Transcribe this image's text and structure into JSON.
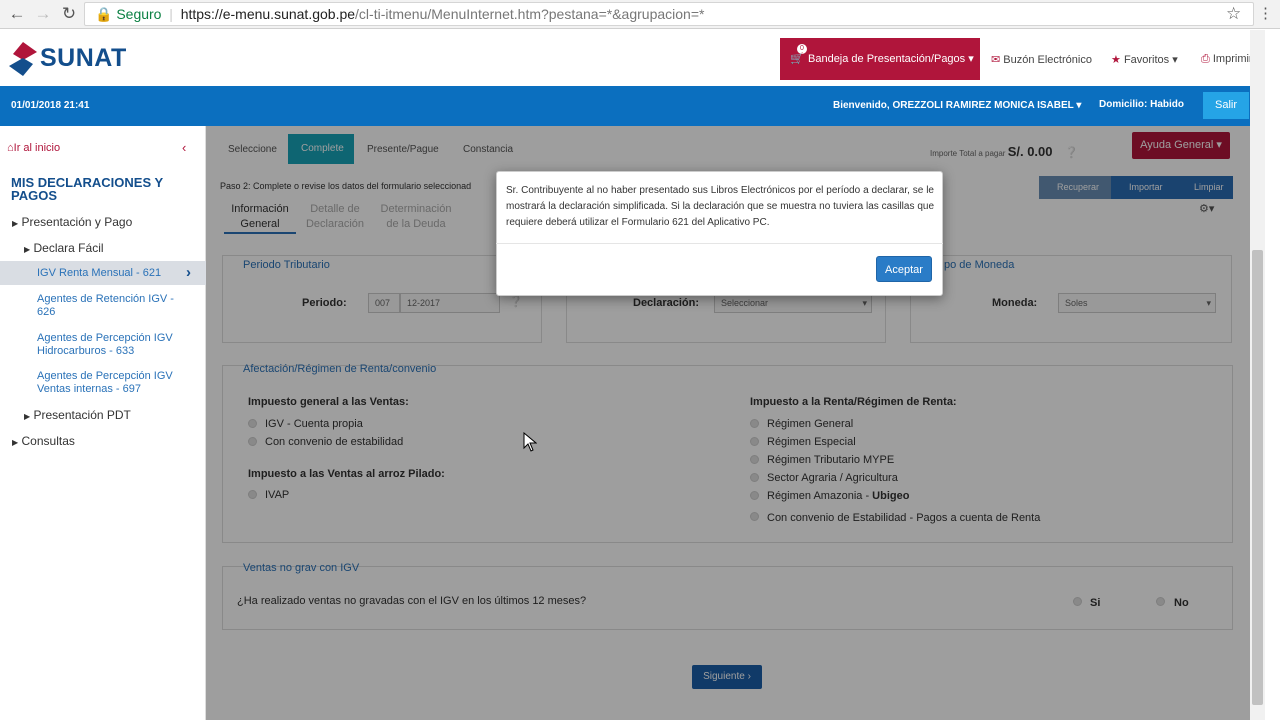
{
  "browser": {
    "secure_label": "Seguro",
    "url_host": "https://e-menu.sunat.gob.pe",
    "url_path": "/cl-ti-itmenu/MenuInternet.htm?pestana=*&agrupacion=*"
  },
  "header": {
    "logo_text": "SUNAT",
    "bandeja_label": "Bandeja de Presentación/Pagos",
    "bandeja_badge": "0",
    "buzon_label": "Buzón Electrónico",
    "favoritos_label": "Favoritos",
    "imprimir_label": "Imprimir"
  },
  "bluebar": {
    "datetime": "01/01/2018 21:41",
    "welcome": "Bienvenido, OREZZOLI RAMIREZ MONICA ISABEL",
    "domicilio": "Domicilio: Habido",
    "salir_label": "Salir"
  },
  "sidebar": {
    "ir_inicio": "Ir al inicio",
    "title": "MIS DECLARACIONES Y PAGOS",
    "presentacion_pago": "Presentación y Pago",
    "declara_facil": "Declara Fácil",
    "items": [
      "IGV Renta Mensual - 621",
      "Agentes de Retención IGV - 626",
      "Agentes de Percepción IGV Hidrocarburos - 633",
      "Agentes de Percepción IGV Ventas internas - 697"
    ],
    "presentacion_pdt": "Presentación PDT",
    "consultas": "Consultas"
  },
  "steps": [
    "Seleccione",
    "Complete",
    "Presente/Pague",
    "Constancia"
  ],
  "importe": {
    "label": "Importe Total a pagar",
    "value": "S/. 0.00"
  },
  "ayuda_label": "Ayuda General",
  "paso_text": "Paso 2: Complete o revise los datos del formulario seleccionad",
  "toolbar": {
    "recuperar": "Recuperar",
    "importar": "Importar",
    "limpiar": "Limpiar"
  },
  "tabs": {
    "info_general": "Información General",
    "detalle": "Detalle de Declaración",
    "determinacion": "Determinación de la Deuda"
  },
  "periodo": {
    "legend": "Periodo Tributario",
    "label": "Periodo:",
    "code": "007",
    "value": "12-2017"
  },
  "declaracion": {
    "label": "Declaración:",
    "value": "Seleccionar"
  },
  "moneda": {
    "legend": "Tipo de Moneda",
    "legend_visible": "po de Moneda",
    "label": "Moneda:",
    "value": "Soles"
  },
  "afectacion": {
    "legend": "Afectación/Régimen de Renta/convenio",
    "igv_heading": "Impuesto general a las Ventas:",
    "igv_options": [
      "IGV - Cuenta propia",
      "Con convenio de estabilidad"
    ],
    "arroz_heading": "Impuesto a las Ventas al arroz Pilado:",
    "arroz_options": [
      "IVAP"
    ],
    "renta_heading": "Impuesto a la Renta/Régimen de Renta:",
    "renta_options": [
      "Régimen General",
      "Régimen Especial",
      "Régimen Tributario MYPE",
      "Sector Agraria / Agricultura",
      "Régimen Amazonia - "
    ],
    "ubigeo": "Ubigeo",
    "convenio_renta": "Con convenio de Estabilidad - Pagos a cuenta de Renta"
  },
  "ventas": {
    "legend": "Ventas no grav con IGV",
    "question": "¿Ha realizado ventas no gravadas con el IGV en los últimos 12 meses?",
    "si": "Si",
    "no": "No"
  },
  "siguiente_label": "Siguiente",
  "modal": {
    "text": "Sr. Contribuyente al no haber presentado sus Libros Electrónicos por el período a declarar, se le mostrará la declaración simplificada. Si la declaración que se muestra no tuviera las casillas que requiere deberá utilizar el Formulario 621 del Aplicativo PC.",
    "aceptar_label": "Aceptar"
  }
}
